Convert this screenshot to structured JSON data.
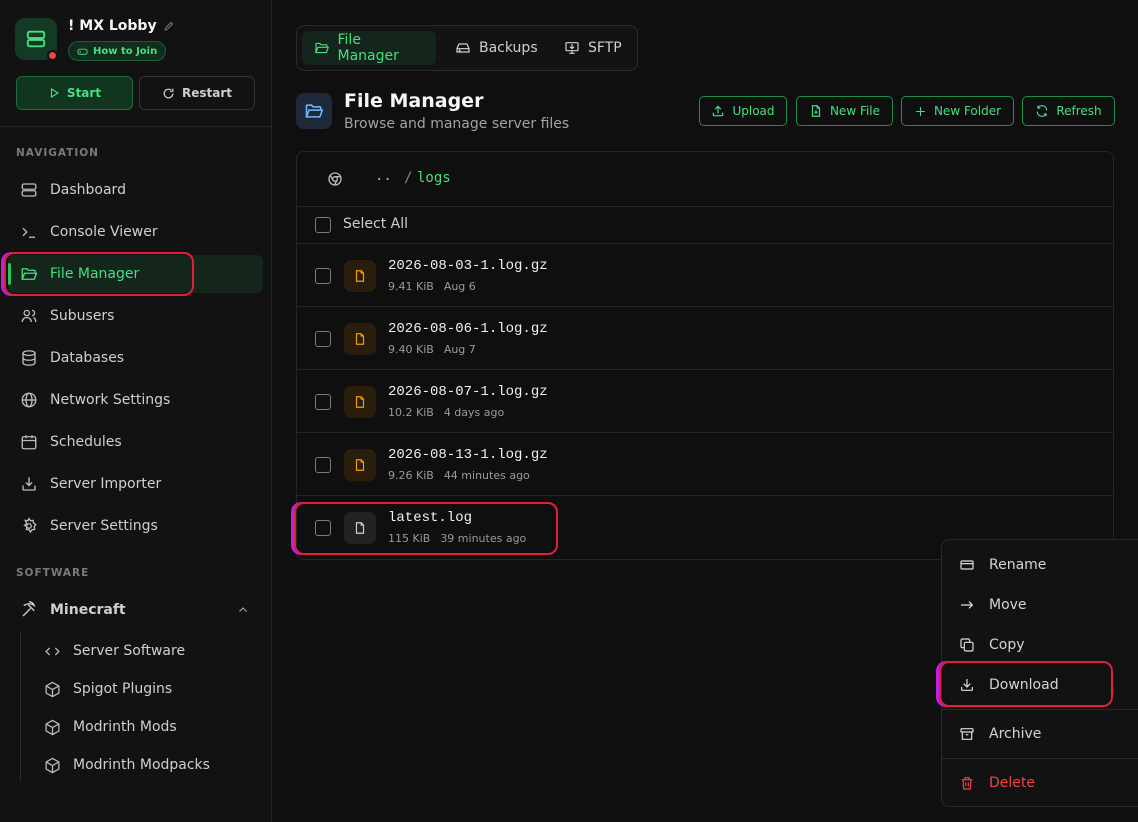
{
  "server": {
    "name": "! MX Lobby",
    "how_to_join": "How to Join",
    "start_label": "Start",
    "restart_label": "Restart"
  },
  "sidebar": {
    "nav_section": "NAVIGATION",
    "items": [
      {
        "label": "Dashboard",
        "icon": "server-icon"
      },
      {
        "label": "Console Viewer",
        "icon": "terminal-icon"
      },
      {
        "label": "File Manager",
        "icon": "folder-open-icon",
        "active": true
      },
      {
        "label": "Subusers",
        "icon": "users-icon"
      },
      {
        "label": "Databases",
        "icon": "database-icon"
      },
      {
        "label": "Network Settings",
        "icon": "globe-icon"
      },
      {
        "label": "Schedules",
        "icon": "calendar-icon"
      },
      {
        "label": "Server Importer",
        "icon": "import-icon"
      },
      {
        "label": "Server Settings",
        "icon": "gear-icon"
      }
    ],
    "software_section": "SOFTWARE",
    "software": {
      "label": "Minecraft",
      "children": [
        {
          "label": "Server Software",
          "icon": "code-icon"
        },
        {
          "label": "Spigot Plugins",
          "icon": "cube-icon"
        },
        {
          "label": "Modrinth Mods",
          "icon": "cube-icon"
        },
        {
          "label": "Modrinth Modpacks",
          "icon": "cube-icon"
        }
      ]
    }
  },
  "tabs": [
    {
      "label": "File Manager",
      "active": true
    },
    {
      "label": "Backups"
    },
    {
      "label": "SFTP"
    }
  ],
  "header": {
    "title": "File Manager",
    "subtitle": "Browse and manage server files",
    "actions": [
      "Upload",
      "New File",
      "New Folder",
      "Refresh"
    ]
  },
  "breadcrumb": {
    "up": "..",
    "separator": "/",
    "current": "logs"
  },
  "select_all": "Select All",
  "files": [
    {
      "name": "2026-08-03-1.log.gz",
      "size": "9.41 KiB",
      "date": "Aug 6"
    },
    {
      "name": "2026-08-06-1.log.gz",
      "size": "9.40 KiB",
      "date": "Aug 7"
    },
    {
      "name": "2026-08-07-1.log.gz",
      "size": "10.2 KiB",
      "date": "4 days ago"
    },
    {
      "name": "2026-08-13-1.log.gz",
      "size": "9.26 KiB",
      "date": "44 minutes ago"
    },
    {
      "name": "latest.log",
      "size": "115 KiB",
      "date": "39 minutes ago"
    }
  ],
  "context_menu": [
    "Rename",
    "Move",
    "Copy",
    "Download",
    "Archive",
    "Delete"
  ],
  "colors": {
    "accent": "#4ade80",
    "danger": "#ef4444",
    "highlight": "#e0203a"
  }
}
